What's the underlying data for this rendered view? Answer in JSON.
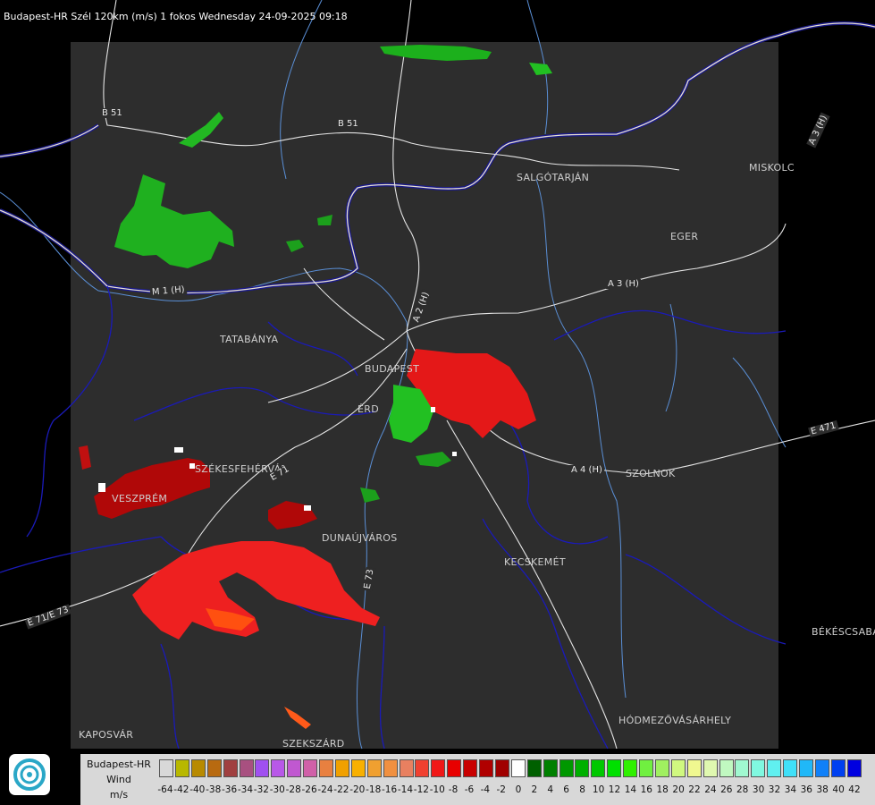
{
  "header": {
    "title": "Budapest-HR Szél 120km (m/s) 1 fokos Wednesday 24-09-2025 09:18"
  },
  "cities": [
    "SALGÓTARJÁN",
    "MISKOLC",
    "EGER",
    "TATABÁNYA",
    "BUDAPEST",
    "ÉRD",
    "SZÉKESFEHÉRVÁR",
    "VESZPRÉM",
    "DUNAÚJVÁROS",
    "KECSKEMÉT",
    "SZOLNOK",
    "BÉKÉSCSABA",
    "HÓDMEZŐVÁSÁRHELY",
    "KAPOSVÁR",
    "SZEKSZÁRD"
  ],
  "roads": [
    "B 51",
    "B 51",
    "A 3 (H)",
    "A 3 (H)",
    "M 1 (H)",
    "A 2 (H)",
    "A 4 (H)",
    "E 71",
    "E 73",
    "E 471",
    "E 71/E 73"
  ],
  "legend": {
    "title_lines": [
      "Budapest-HR",
      "Wind",
      "m/s"
    ],
    "ticks": [
      "-64",
      "-42",
      "-40",
      "-38",
      "-36",
      "-34",
      "-32",
      "-30",
      "-28",
      "-26",
      "-24",
      "-22",
      "-20",
      "-18",
      "-16",
      "-14",
      "-12",
      "-10",
      "-8",
      "-6",
      "-4",
      "-2",
      "0",
      "2",
      "4",
      "6",
      "8",
      "10",
      "12",
      "14",
      "16",
      "18",
      "20",
      "22",
      "24",
      "26",
      "28",
      "30",
      "32",
      "34",
      "36",
      "38",
      "40",
      "42"
    ],
    "colors": [
      "#d8d8d8",
      "#b8b800",
      "#b88a00",
      "#b86a10",
      "#a04040",
      "#a85080",
      "#a050f0",
      "#b858e8",
      "#c058d0",
      "#d060a8",
      "#e88040",
      "#f0a000",
      "#f8b000",
      "#f0a030",
      "#f09040",
      "#e88060",
      "#f04030",
      "#f01818",
      "#e80000",
      "#c80000",
      "#b00000",
      "#a00000",
      "#ffffff",
      "#006000",
      "#008000",
      "#009800",
      "#00b000",
      "#00c800",
      "#00e000",
      "#30f000",
      "#70f040",
      "#a0f060",
      "#d0f880",
      "#f0f890",
      "#e0f8b0",
      "#c0f8c0",
      "#a0f8d0",
      "#80f8e0",
      "#60f0f0",
      "#40e0f8",
      "#20b8f8",
      "#1080f8",
      "#0040f0",
      "#0000e0"
    ],
    "logo_icon": "omsz-logo-icon"
  }
}
